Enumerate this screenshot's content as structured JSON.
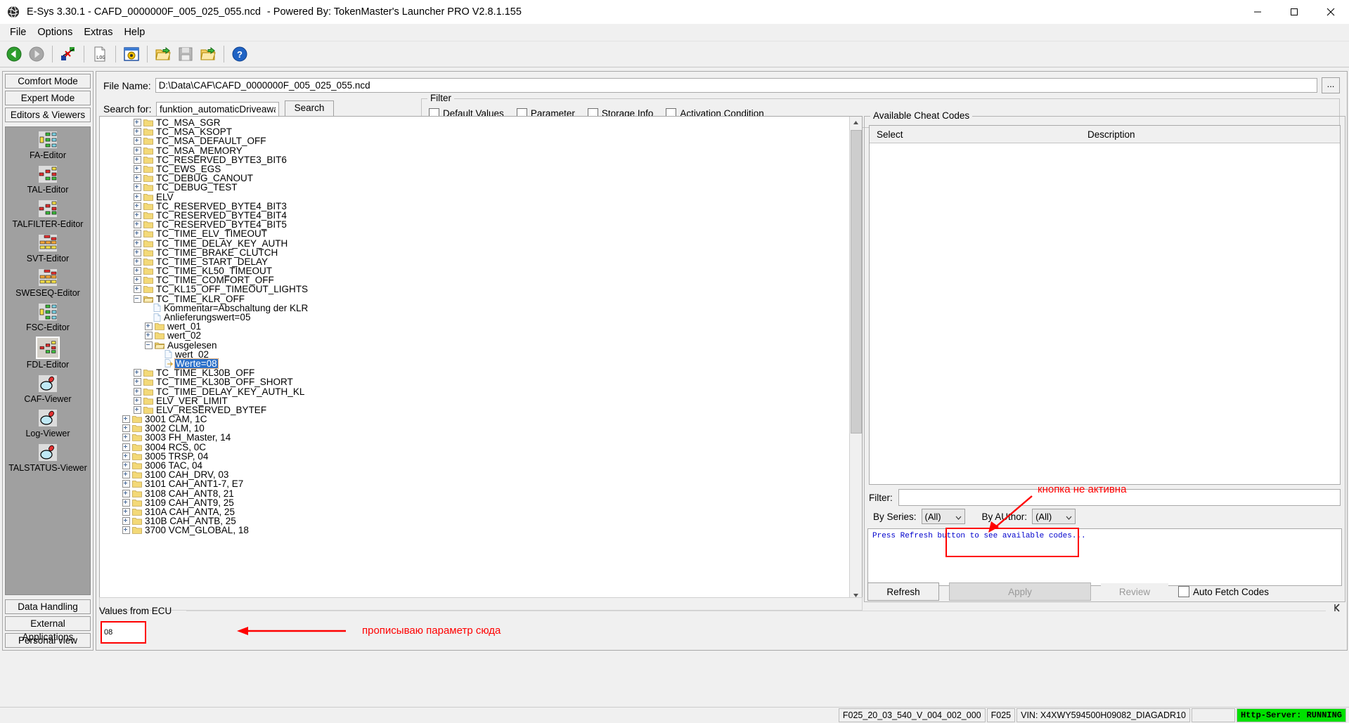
{
  "window": {
    "title": "E-Sys 3.30.1 - CAFD_0000000F_005_025_055.ncd",
    "subtitle": "- Powered By: TokenMaster's Launcher PRO V2.8.1.155",
    "app_icon": "esys-globe-icon",
    "minimize": "minimize-icon",
    "maximize": "maximize-icon",
    "close": "close-icon"
  },
  "menu": [
    {
      "label": "File"
    },
    {
      "label": "Options"
    },
    {
      "label": "Extras"
    },
    {
      "label": "Help"
    }
  ],
  "toolbar": [
    {
      "name": "back-icon"
    },
    {
      "name": "forward-icon"
    },
    {
      "name": "disconnect-icon"
    },
    {
      "name": "log-icon"
    },
    {
      "name": "target-window-icon"
    },
    {
      "name": "open-folder-icon"
    },
    {
      "name": "save-icon"
    },
    {
      "name": "open-folder-green-icon"
    },
    {
      "name": "help-icon"
    }
  ],
  "sidebar": {
    "modes": [
      {
        "label": "Comfort Mode"
      },
      {
        "label": "Expert Mode"
      },
      {
        "label": "Editors & Viewers"
      }
    ],
    "items": [
      {
        "label": "FA-Editor",
        "icon": "tree-editor-icon",
        "selected": false
      },
      {
        "label": "TAL-Editor",
        "icon": "tal-editor-icon",
        "selected": false
      },
      {
        "label": "TALFILTER-Editor",
        "icon": "tal-editor-icon",
        "selected": false
      },
      {
        "label": "SVT-Editor",
        "icon": "svt-editor-icon",
        "selected": false
      },
      {
        "label": "SWESEQ-Editor",
        "icon": "svt-editor-icon",
        "selected": false
      },
      {
        "label": "FSC-Editor",
        "icon": "tree-editor-icon",
        "selected": false
      },
      {
        "label": "FDL-Editor",
        "icon": "tal-editor-icon",
        "selected": true
      },
      {
        "label": "CAF-Viewer",
        "icon": "magnifier-icon",
        "selected": false
      },
      {
        "label": "Log-Viewer",
        "icon": "magnifier-icon",
        "selected": false
      },
      {
        "label": "TALSTATUS-Viewer",
        "icon": "magnifier-icon",
        "selected": false
      }
    ],
    "bottom": [
      {
        "label": "Data Handling"
      },
      {
        "label": "External Applications"
      },
      {
        "label": "Personal view"
      }
    ]
  },
  "file_row": {
    "label": "File Name:",
    "value": "D:\\Data\\CAF\\CAFD_0000000F_005_025_055.ncd",
    "browse_label": "..."
  },
  "search_row": {
    "label": "Search for:",
    "value": "funktion_automaticDriveaway",
    "button_label": "Search"
  },
  "filter": {
    "legend": "Filter",
    "options": [
      {
        "label": "Default Values",
        "checked": false
      },
      {
        "label": "Parameter",
        "checked": false
      },
      {
        "label": "Storage Info",
        "checked": false
      },
      {
        "label": "Activation Condition",
        "checked": false
      }
    ]
  },
  "tree": [
    {
      "indent": 2,
      "expander": "plus",
      "icon": "folder",
      "label": "TC_MSA_SGR"
    },
    {
      "indent": 2,
      "expander": "plus",
      "icon": "folder",
      "label": "TC_MSA_KSOPT"
    },
    {
      "indent": 2,
      "expander": "plus",
      "icon": "folder",
      "label": "TC_MSA_DEFAULT_OFF"
    },
    {
      "indent": 2,
      "expander": "plus",
      "icon": "folder",
      "label": "TC_MSA_MEMORY"
    },
    {
      "indent": 2,
      "expander": "plus",
      "icon": "folder",
      "label": "TC_RESERVED_BYTE3_BIT6"
    },
    {
      "indent": 2,
      "expander": "plus",
      "icon": "folder",
      "label": "TC_EWS_EGS"
    },
    {
      "indent": 2,
      "expander": "plus",
      "icon": "folder",
      "label": "TC_DEBUG_CANOUT"
    },
    {
      "indent": 2,
      "expander": "plus",
      "icon": "folder",
      "label": "TC_DEBUG_TEST"
    },
    {
      "indent": 2,
      "expander": "plus",
      "icon": "folder",
      "label": "ELV"
    },
    {
      "indent": 2,
      "expander": "plus",
      "icon": "folder",
      "label": "TC_RESERVED_BYTE4_BIT3"
    },
    {
      "indent": 2,
      "expander": "plus",
      "icon": "folder",
      "label": "TC_RESERVED_BYTE4_BIT4"
    },
    {
      "indent": 2,
      "expander": "plus",
      "icon": "folder",
      "label": "TC_RESERVED_BYTE4_BIT5"
    },
    {
      "indent": 2,
      "expander": "plus",
      "icon": "folder",
      "label": "TC_TIME_ELV_TIMEOUT"
    },
    {
      "indent": 2,
      "expander": "plus",
      "icon": "folder",
      "label": "TC_TIME_DELAY_KEY_AUTH"
    },
    {
      "indent": 2,
      "expander": "plus",
      "icon": "folder",
      "label": "TC_TIME_BRAKE_CLUTCH"
    },
    {
      "indent": 2,
      "expander": "plus",
      "icon": "folder",
      "label": "TC_TIME_START_DELAY"
    },
    {
      "indent": 2,
      "expander": "plus",
      "icon": "folder",
      "label": "TC_TIME_KL50_TIMEOUT"
    },
    {
      "indent": 2,
      "expander": "plus",
      "icon": "folder",
      "label": "TC_TIME_COMFORT_OFF"
    },
    {
      "indent": 2,
      "expander": "plus",
      "icon": "folder",
      "label": "TC_KL15_OFF_TIMEOUT_LIGHTS"
    },
    {
      "indent": 2,
      "expander": "minus",
      "icon": "folder-open",
      "label": "TC_TIME_KLR_OFF"
    },
    {
      "indent": 3,
      "expander": "none",
      "icon": "doc",
      "label": "Kommentar=Abschaltung der KLR"
    },
    {
      "indent": 3,
      "expander": "none",
      "icon": "doc",
      "label": "Anlieferungswert=05"
    },
    {
      "indent": 3,
      "expander": "plus",
      "icon": "folder",
      "label": "wert_01"
    },
    {
      "indent": 3,
      "expander": "plus",
      "icon": "folder",
      "label": "wert_02"
    },
    {
      "indent": 3,
      "expander": "minus",
      "icon": "folder-open",
      "label": "Ausgelesen"
    },
    {
      "indent": 4,
      "expander": "none",
      "icon": "doc",
      "label": "wert_02"
    },
    {
      "indent": 4,
      "expander": "none",
      "icon": "doc-arrow",
      "label": "Werte=08",
      "selected": true
    },
    {
      "indent": 2,
      "expander": "plus",
      "icon": "folder",
      "label": "TC_TIME_KL30B_OFF"
    },
    {
      "indent": 2,
      "expander": "plus",
      "icon": "folder",
      "label": "TC_TIME_KL30B_OFF_SHORT"
    },
    {
      "indent": 2,
      "expander": "plus",
      "icon": "folder",
      "label": "TC_TIME_DELAY_KEY_AUTH_KL"
    },
    {
      "indent": 2,
      "expander": "plus",
      "icon": "folder",
      "label": "ELV_VER_LIMIT"
    },
    {
      "indent": 2,
      "expander": "plus",
      "icon": "folder",
      "label": "ELV_RESERVED_BYTEF"
    },
    {
      "indent": 1,
      "expander": "plus",
      "icon": "folder",
      "label": "3001 CAM, 1C"
    },
    {
      "indent": 1,
      "expander": "plus",
      "icon": "folder",
      "label": "3002 CLM, 10"
    },
    {
      "indent": 1,
      "expander": "plus",
      "icon": "folder",
      "label": "3003 FH_Master, 14"
    },
    {
      "indent": 1,
      "expander": "plus",
      "icon": "folder",
      "label": "3004 RCS, 0C"
    },
    {
      "indent": 1,
      "expander": "plus",
      "icon": "folder",
      "label": "3005 TRSP, 04"
    },
    {
      "indent": 1,
      "expander": "plus",
      "icon": "folder",
      "label": "3006 TAC, 04"
    },
    {
      "indent": 1,
      "expander": "plus",
      "icon": "folder",
      "label": "3100 CAH_DRV, 03"
    },
    {
      "indent": 1,
      "expander": "plus",
      "icon": "folder",
      "label": "3101 CAH_ANT1-7, E7"
    },
    {
      "indent": 1,
      "expander": "plus",
      "icon": "folder",
      "label": "3108 CAH_ANT8, 21"
    },
    {
      "indent": 1,
      "expander": "plus",
      "icon": "folder",
      "label": "3109 CAH_ANT9, 25"
    },
    {
      "indent": 1,
      "expander": "plus",
      "icon": "folder",
      "label": "310A CAH_ANTA, 25"
    },
    {
      "indent": 1,
      "expander": "plus",
      "icon": "folder",
      "label": "310B CAH_ANTB, 25"
    },
    {
      "indent": 1,
      "expander": "plus",
      "icon": "folder",
      "label": "3700 VCM_GLOBAL, 18"
    }
  ],
  "cheat_codes": {
    "legend": "Available Cheat Codes",
    "columns": {
      "select": "Select",
      "description": "Description"
    },
    "rows": [],
    "filter_label": "Filter:",
    "filter_value": "",
    "by_series_label": "By Series:",
    "by_series_value": "(All)",
    "by_author_label": "By AUthor:",
    "by_author_value": "(All)",
    "log_text": "Press Refresh button to see available codes...",
    "refresh_label": "Refresh",
    "apply_label": "Apply",
    "review_label": "Review",
    "auto_fetch_label": "Auto Fetch Codes",
    "auto_fetch_checked": false
  },
  "values_from_ecu": {
    "title": "Values from ECU",
    "input_value": "08",
    "collapse_icon": "collapse-left-icon"
  },
  "annotations": [
    {
      "text": "кнопка не активна",
      "color": "#ff0000"
    },
    {
      "text": "прописываю параметр сюда",
      "color": "#ff0000"
    }
  ],
  "statusbar": {
    "ivalue": "F025_20_03_540_V_004_002_000",
    "series": "F025",
    "vin": "VIN: X4XWY594500H09082_DIAGADR10",
    "empty": "",
    "server": "Http-Server: RUNNING",
    "server_color": "#00e000"
  }
}
